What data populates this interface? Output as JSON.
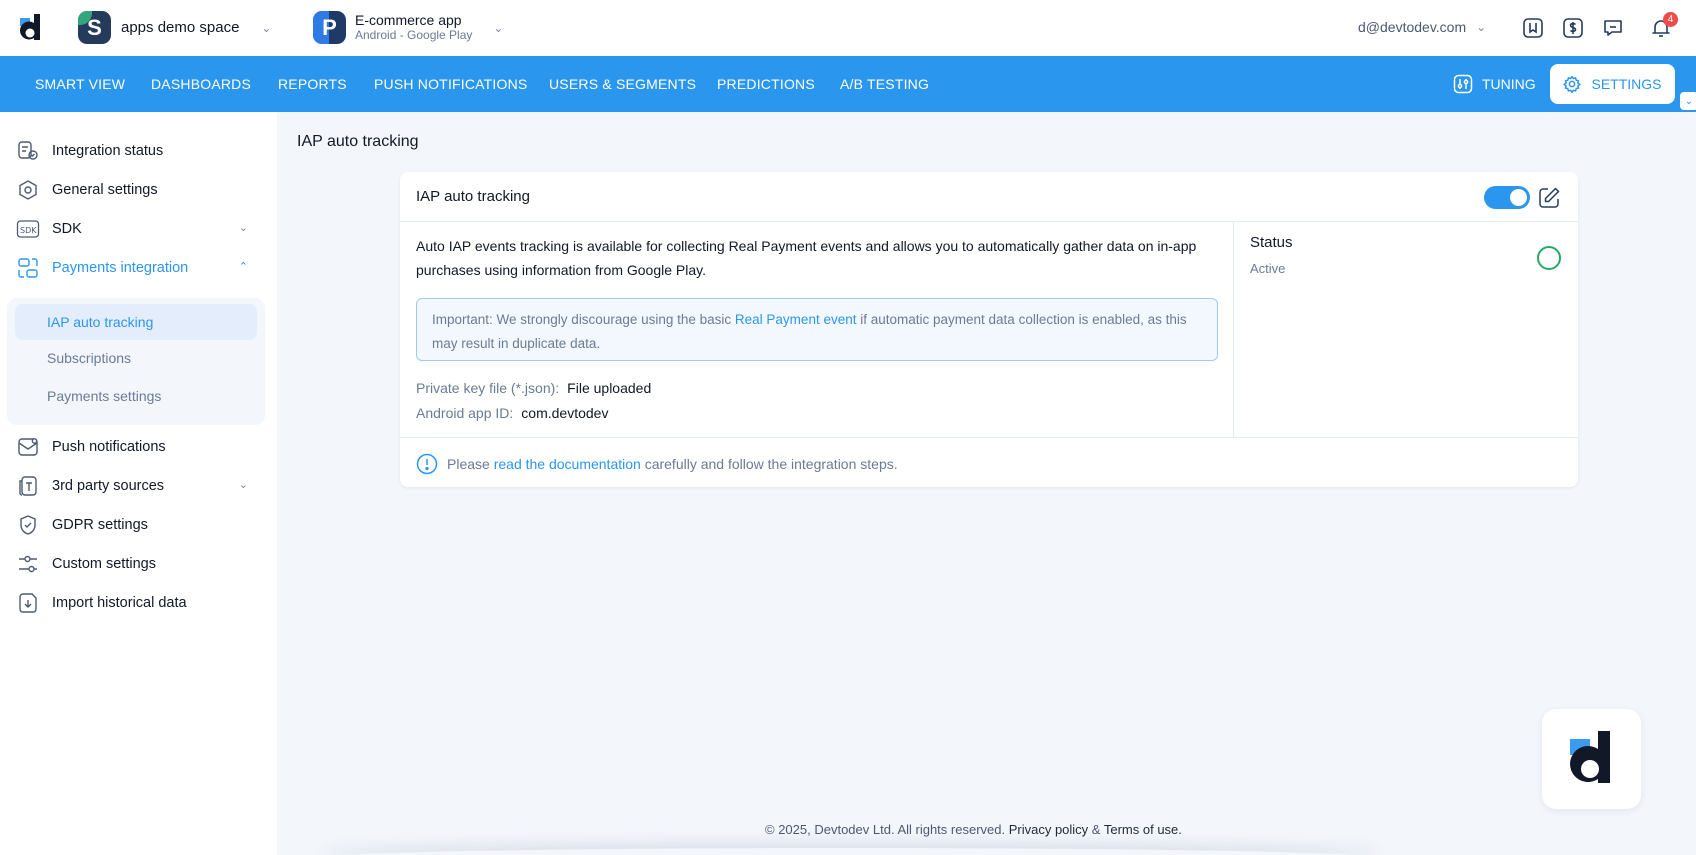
{
  "header": {
    "space_name": "apps demo space",
    "space_initial": "S",
    "app_name": "E-commerce app",
    "app_platform": "Android - Google Play",
    "app_initial": "P",
    "user_email": "d@devtodev.com",
    "notification_count": "4"
  },
  "nav": {
    "items": [
      "SMART VIEW",
      "DASHBOARDS",
      "REPORTS",
      "PUSH NOTIFICATIONS",
      "USERS & SEGMENTS",
      "PREDICTIONS",
      "A/B TESTING"
    ],
    "tuning": "TUNING",
    "settings": "SETTINGS"
  },
  "sidebar": {
    "items": [
      "Integration status",
      "General settings",
      "SDK",
      "Payments integration",
      "Push notifications",
      "3rd party sources",
      "GDPR settings",
      "Custom settings",
      "Import historical data"
    ],
    "sub_items": [
      "IAP auto tracking",
      "Subscriptions",
      "Payments settings"
    ]
  },
  "main": {
    "page_title": "IAP auto tracking",
    "card_title": "IAP auto tracking",
    "description": "Auto IAP events tracking is available for collecting Real Payment events and allows you to automatically gather data on in-app purchases using information from Google Play.",
    "warning_prefix": "Important: We strongly discourage using the basic ",
    "warning_link": "Real Payment event",
    "warning_suffix": " if automatic payment data collection is enabled, as this may result in duplicate data.",
    "private_key_label": "Private key file (*.json):",
    "private_key_value": "File uploaded",
    "app_id_label": "Android app ID:",
    "app_id_value": "com.devtodev",
    "status_label": "Status",
    "status_value": "Active",
    "footer_prefix": "Please ",
    "footer_link": "read the documentation",
    "footer_suffix": " carefully and follow the integration steps."
  },
  "footer": {
    "copyright": "© 2025, Devtodev Ltd. All rights reserved.",
    "privacy": "Privacy policy",
    "amp": " & ",
    "terms": "Terms of use."
  },
  "colors": {
    "accent": "#2b96ee",
    "status_ok": "#27a86b",
    "badge": "#f04a4a"
  }
}
